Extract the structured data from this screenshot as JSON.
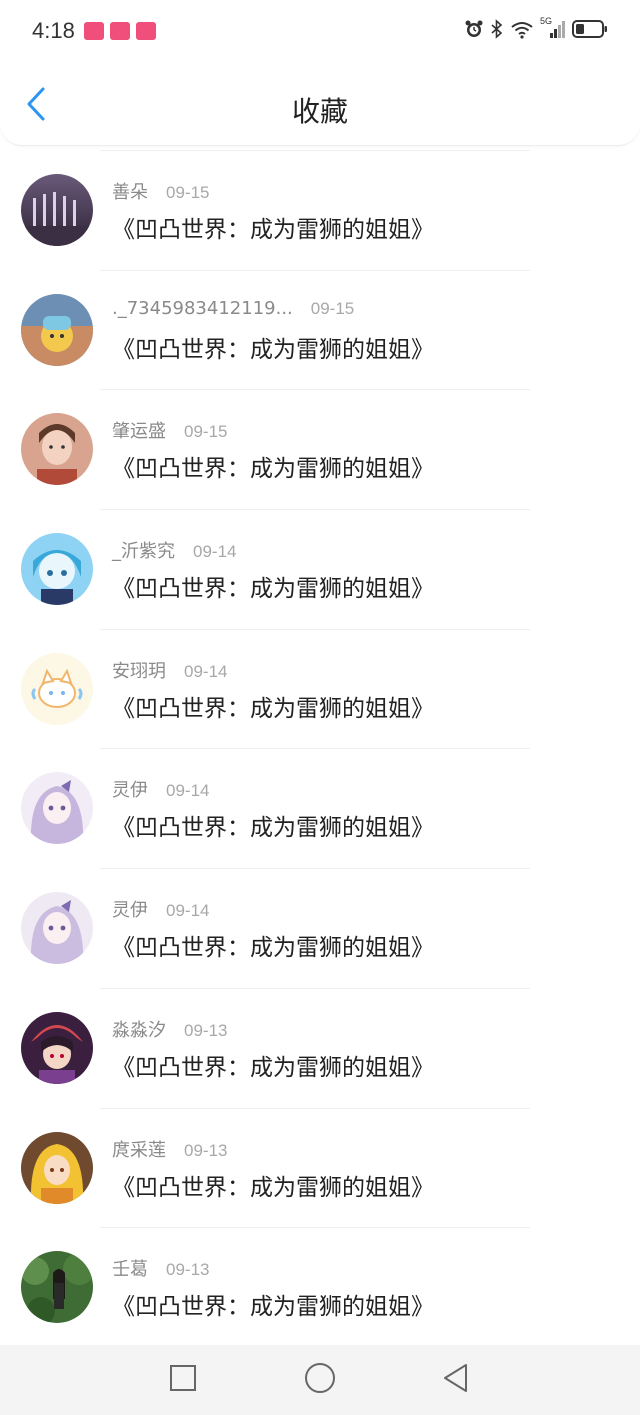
{
  "status_bar": {
    "time": "4:18",
    "badge_color": "#ef4f7a",
    "icons": [
      "alarm-icon",
      "bluetooth-icon",
      "wifi-icon",
      "signal-5g-icon",
      "battery-icon"
    ],
    "network_label": "5G"
  },
  "header": {
    "title": "收藏",
    "back_icon": "chevron-left-icon",
    "accent_color": "#2b95f6"
  },
  "items": [
    {
      "username": "善朵",
      "date": "09-15",
      "title": "《凹凸世界：成为雷狮的姐姐》"
    },
    {
      "username": "._7345983412119...",
      "date": "09-15",
      "title": "《凹凸世界：成为雷狮的姐姐》"
    },
    {
      "username": "肇运盛",
      "date": "09-15",
      "title": "《凹凸世界：成为雷狮的姐姐》"
    },
    {
      "username": "_沂紫究",
      "date": "09-14",
      "title": "《凹凸世界：成为雷狮的姐姐》"
    },
    {
      "username": "安珝玥",
      "date": "09-14",
      "title": "《凹凸世界：成为雷狮的姐姐》"
    },
    {
      "username": "灵伊",
      "date": "09-14",
      "title": "《凹凸世界：成为雷狮的姐姐》"
    },
    {
      "username": "灵伊",
      "date": "09-14",
      "title": "《凹凸世界：成为雷狮的姐姐》"
    },
    {
      "username": "淼淼汐",
      "date": "09-13",
      "title": "《凹凸世界：成为雷狮的姐姐》"
    },
    {
      "username": "庹采莲",
      "date": "09-13",
      "title": "《凹凸世界：成为雷狮的姐姐》"
    },
    {
      "username": "壬葛",
      "date": "09-13",
      "title": "《凹凸世界：成为雷狮的姐姐》"
    }
  ],
  "nav_bar": {
    "buttons": [
      "recent-apps-icon",
      "home-icon",
      "back-triangle-icon"
    ]
  }
}
